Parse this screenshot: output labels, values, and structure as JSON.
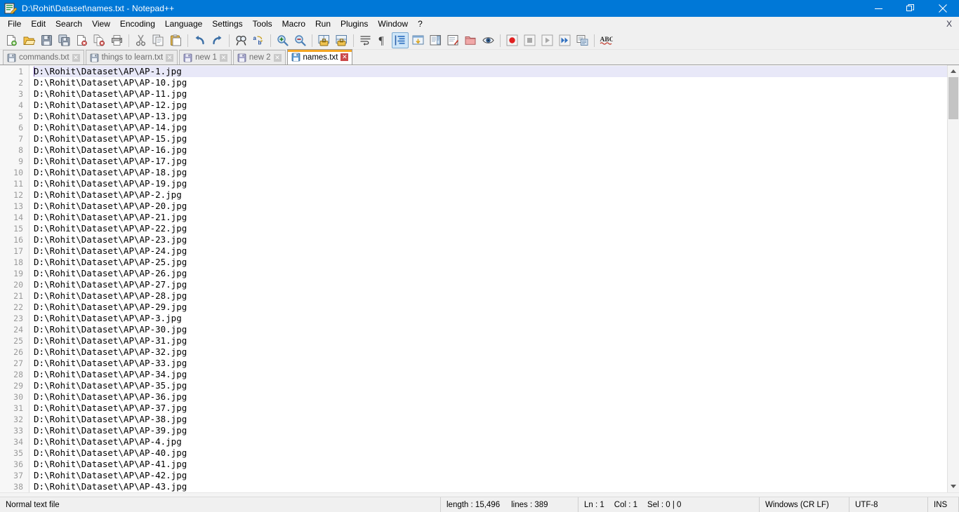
{
  "window": {
    "title": "D:\\Rohit\\Dataset\\names.txt - Notepad++",
    "app_icon": "notepad-plus-plus-icon",
    "controls": [
      {
        "name": "minimize-button",
        "glyph": "—"
      },
      {
        "name": "restore-button",
        "glyph": "❐"
      },
      {
        "name": "close-button",
        "glyph": "✕"
      }
    ]
  },
  "menubar": {
    "items": [
      {
        "label": "File"
      },
      {
        "label": "Edit"
      },
      {
        "label": "Search"
      },
      {
        "label": "View"
      },
      {
        "label": "Encoding"
      },
      {
        "label": "Language"
      },
      {
        "label": "Settings"
      },
      {
        "label": "Tools"
      },
      {
        "label": "Macro"
      },
      {
        "label": "Run"
      },
      {
        "label": "Plugins"
      },
      {
        "label": "Window"
      },
      {
        "label": "?"
      }
    ],
    "close_document_label": "X"
  },
  "toolbar": {
    "buttons": [
      {
        "name": "new-file-icon",
        "title": "New"
      },
      {
        "name": "open-file-icon",
        "title": "Open"
      },
      {
        "name": "save-icon",
        "title": "Save"
      },
      {
        "name": "save-all-icon",
        "title": "Save All"
      },
      {
        "name": "close-file-icon",
        "title": "Close"
      },
      {
        "name": "close-all-files-icon",
        "title": "Close All"
      },
      {
        "name": "print-icon",
        "title": "Print"
      },
      {
        "name": "cut-icon",
        "title": "Cut"
      },
      {
        "name": "copy-icon",
        "title": "Copy"
      },
      {
        "name": "paste-icon",
        "title": "Paste"
      },
      {
        "name": "undo-icon",
        "title": "Undo"
      },
      {
        "name": "redo-icon",
        "title": "Redo"
      },
      {
        "name": "find-icon",
        "title": "Find"
      },
      {
        "name": "replace-icon",
        "title": "Replace"
      },
      {
        "name": "zoom-in-icon",
        "title": "Zoom In"
      },
      {
        "name": "zoom-out-icon",
        "title": "Zoom Out"
      },
      {
        "name": "sync-vertical-scroll-icon",
        "title": "Synchronize Vertical Scrolling"
      },
      {
        "name": "sync-horizontal-scroll-icon",
        "title": "Synchronize Horizontal Scrolling"
      },
      {
        "name": "word-wrap-icon",
        "title": "Word wrap"
      },
      {
        "name": "show-all-characters-icon",
        "title": "Show All Characters"
      },
      {
        "name": "indent-guideline-icon",
        "title": "Show Indent Guide",
        "active": true
      },
      {
        "name": "user-defined-dialog-icon",
        "title": "User-Defined Dialogue"
      },
      {
        "name": "document-map-icon",
        "title": "Document Map"
      },
      {
        "name": "function-list-icon",
        "title": "Function List"
      },
      {
        "name": "folder-as-workspace-icon",
        "title": "Folder as Workspace"
      },
      {
        "name": "monitoring-eye-icon",
        "title": "Monitoring"
      },
      {
        "name": "record-macro-icon",
        "title": "Start Recording"
      },
      {
        "name": "stop-macro-icon",
        "title": "Stop Recording"
      },
      {
        "name": "play-macro-icon",
        "title": "Playback"
      },
      {
        "name": "run-macro-multiple-icon",
        "title": "Run a Macro Multiple Times"
      },
      {
        "name": "save-macro-icon",
        "title": "Save Current Recorded Macro"
      },
      {
        "name": "spell-check-icon",
        "title": "Spell Checker"
      }
    ]
  },
  "tabs": {
    "items": [
      {
        "label": "commands.txt",
        "active": false,
        "close_glyph": "✕"
      },
      {
        "label": "things to learn.txt",
        "active": false,
        "close_glyph": "✕"
      },
      {
        "label": "new 1",
        "active": false,
        "close_glyph": "✕"
      },
      {
        "label": "new 2",
        "active": false,
        "close_glyph": "✕"
      },
      {
        "label": "names.txt",
        "active": true,
        "close_glyph": "✕"
      }
    ]
  },
  "editor": {
    "cursor_line": 1,
    "lines": [
      {
        "n": 1,
        "text": "D:\\Rohit\\Dataset\\AP\\AP-1.jpg"
      },
      {
        "n": 2,
        "text": "D:\\Rohit\\Dataset\\AP\\AP-10.jpg"
      },
      {
        "n": 3,
        "text": "D:\\Rohit\\Dataset\\AP\\AP-11.jpg"
      },
      {
        "n": 4,
        "text": "D:\\Rohit\\Dataset\\AP\\AP-12.jpg"
      },
      {
        "n": 5,
        "text": "D:\\Rohit\\Dataset\\AP\\AP-13.jpg"
      },
      {
        "n": 6,
        "text": "D:\\Rohit\\Dataset\\AP\\AP-14.jpg"
      },
      {
        "n": 7,
        "text": "D:\\Rohit\\Dataset\\AP\\AP-15.jpg"
      },
      {
        "n": 8,
        "text": "D:\\Rohit\\Dataset\\AP\\AP-16.jpg"
      },
      {
        "n": 9,
        "text": "D:\\Rohit\\Dataset\\AP\\AP-17.jpg"
      },
      {
        "n": 10,
        "text": "D:\\Rohit\\Dataset\\AP\\AP-18.jpg"
      },
      {
        "n": 11,
        "text": "D:\\Rohit\\Dataset\\AP\\AP-19.jpg"
      },
      {
        "n": 12,
        "text": "D:\\Rohit\\Dataset\\AP\\AP-2.jpg"
      },
      {
        "n": 13,
        "text": "D:\\Rohit\\Dataset\\AP\\AP-20.jpg"
      },
      {
        "n": 14,
        "text": "D:\\Rohit\\Dataset\\AP\\AP-21.jpg"
      },
      {
        "n": 15,
        "text": "D:\\Rohit\\Dataset\\AP\\AP-22.jpg"
      },
      {
        "n": 16,
        "text": "D:\\Rohit\\Dataset\\AP\\AP-23.jpg"
      },
      {
        "n": 17,
        "text": "D:\\Rohit\\Dataset\\AP\\AP-24.jpg"
      },
      {
        "n": 18,
        "text": "D:\\Rohit\\Dataset\\AP\\AP-25.jpg"
      },
      {
        "n": 19,
        "text": "D:\\Rohit\\Dataset\\AP\\AP-26.jpg"
      },
      {
        "n": 20,
        "text": "D:\\Rohit\\Dataset\\AP\\AP-27.jpg"
      },
      {
        "n": 21,
        "text": "D:\\Rohit\\Dataset\\AP\\AP-28.jpg"
      },
      {
        "n": 22,
        "text": "D:\\Rohit\\Dataset\\AP\\AP-29.jpg"
      },
      {
        "n": 23,
        "text": "D:\\Rohit\\Dataset\\AP\\AP-3.jpg"
      },
      {
        "n": 24,
        "text": "D:\\Rohit\\Dataset\\AP\\AP-30.jpg"
      },
      {
        "n": 25,
        "text": "D:\\Rohit\\Dataset\\AP\\AP-31.jpg"
      },
      {
        "n": 26,
        "text": "D:\\Rohit\\Dataset\\AP\\AP-32.jpg"
      },
      {
        "n": 27,
        "text": "D:\\Rohit\\Dataset\\AP\\AP-33.jpg"
      },
      {
        "n": 28,
        "text": "D:\\Rohit\\Dataset\\AP\\AP-34.jpg"
      },
      {
        "n": 29,
        "text": "D:\\Rohit\\Dataset\\AP\\AP-35.jpg"
      },
      {
        "n": 30,
        "text": "D:\\Rohit\\Dataset\\AP\\AP-36.jpg"
      },
      {
        "n": 31,
        "text": "D:\\Rohit\\Dataset\\AP\\AP-37.jpg"
      },
      {
        "n": 32,
        "text": "D:\\Rohit\\Dataset\\AP\\AP-38.jpg"
      },
      {
        "n": 33,
        "text": "D:\\Rohit\\Dataset\\AP\\AP-39.jpg"
      },
      {
        "n": 34,
        "text": "D:\\Rohit\\Dataset\\AP\\AP-4.jpg"
      },
      {
        "n": 35,
        "text": "D:\\Rohit\\Dataset\\AP\\AP-40.jpg"
      },
      {
        "n": 36,
        "text": "D:\\Rohit\\Dataset\\AP\\AP-41.jpg"
      },
      {
        "n": 37,
        "text": "D:\\Rohit\\Dataset\\AP\\AP-42.jpg"
      },
      {
        "n": 38,
        "text": "D:\\Rohit\\Dataset\\AP\\AP-43.jpg"
      }
    ]
  },
  "statusbar": {
    "doc_type": "Normal text file",
    "length_label": "length : 15,496",
    "lines_label": "lines : 389",
    "ln_label": "Ln : 1",
    "col_label": "Col : 1",
    "sel_label": "Sel : 0 | 0",
    "eol": "Windows (CR LF)",
    "encoding": "UTF-8",
    "insert_mode": "INS"
  },
  "colors": {
    "titlebar": "#0078d7",
    "active_tab_accent": "#f5a623",
    "current_line_highlight": "#e8e8f8",
    "chrome": "#f0f0f0"
  }
}
